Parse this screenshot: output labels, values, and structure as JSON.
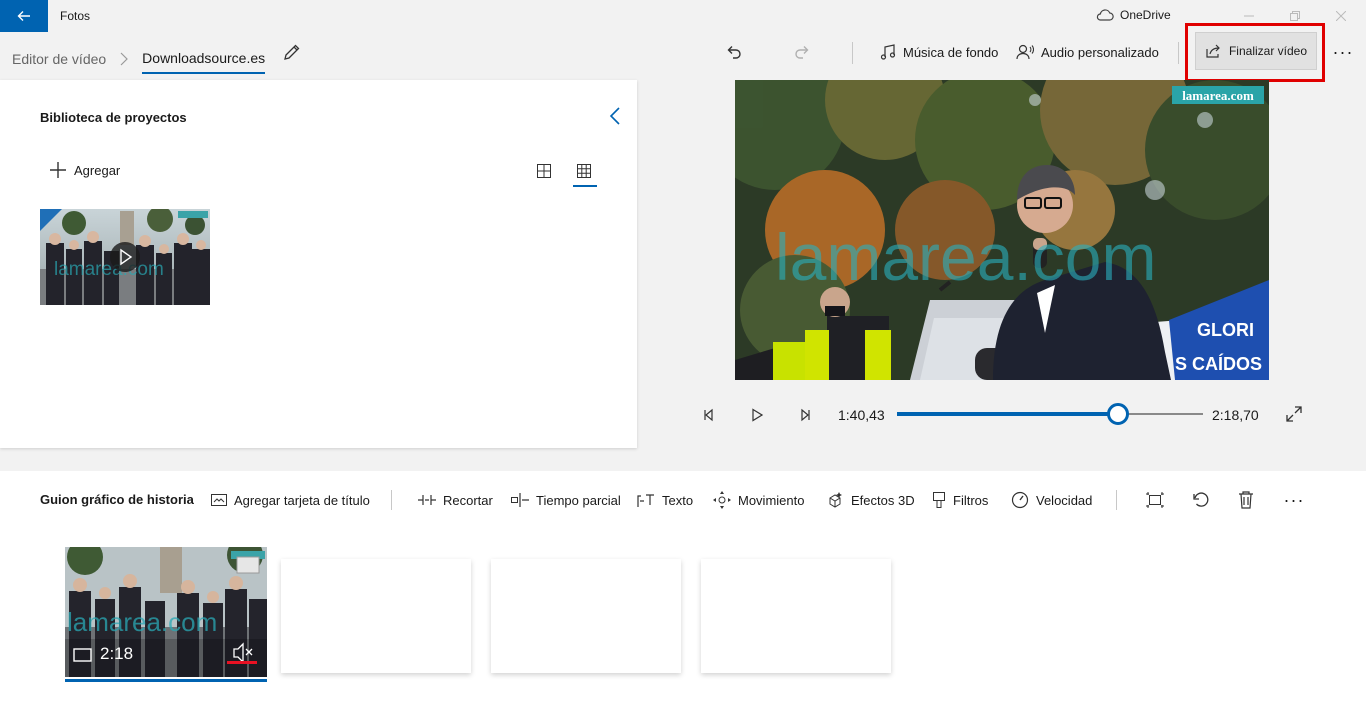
{
  "titlebar": {
    "app_name": "Fotos",
    "onedrive_label": "OneDrive"
  },
  "header": {
    "breadcrumb_root": "Editor de vídeo",
    "project_name": "Downloadsource.es",
    "music_label": "Música de fondo",
    "custom_audio_label": "Audio personalizado",
    "finalize_label": "Finalizar vídeo",
    "more_label": "···"
  },
  "library": {
    "title": "Biblioteca de proyectos",
    "add_label": "Agregar"
  },
  "preview": {
    "watermark_badge": "lamarea.com",
    "watermark_big": "lamarea.com",
    "banner_text_1": "GLORI",
    "banner_text_2": "S CAÍDOS",
    "current_time": "1:40,43",
    "total_time": "2:18,70",
    "progress_fraction": 0.7238
  },
  "storyboard": {
    "title": "Guion gráfico de historia",
    "add_title_card_label": "Agregar tarjeta de título",
    "trim_label": "Recortar",
    "split_label": "Tiempo parcial",
    "text_label": "Texto",
    "motion_label": "Movimiento",
    "effects3d_label": "Efectos 3D",
    "filters_label": "Filtros",
    "speed_label": "Velocidad",
    "more_label": "···",
    "clip": {
      "duration": "2:18",
      "watermark": "lamarea.com"
    }
  },
  "colors": {
    "accent": "#0063b1",
    "highlight_red": "#e00000",
    "mute_red": "#e81123"
  }
}
